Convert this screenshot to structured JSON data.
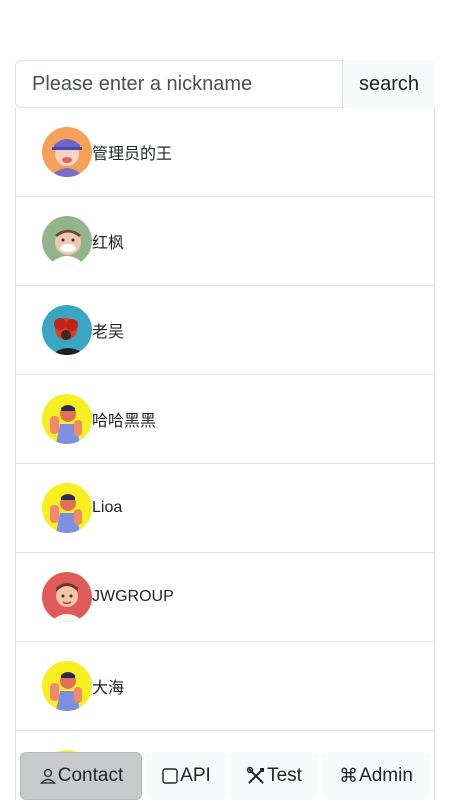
{
  "search": {
    "placeholder": "Please enter a nickname",
    "button_label": "search"
  },
  "contacts": [
    {
      "name": "管理员的王",
      "avatar": "orange-cap-avatar"
    },
    {
      "name": "红枫",
      "avatar": "green-old-man-avatar"
    },
    {
      "name": "老吴",
      "avatar": "teal-red-hair-avatar"
    },
    {
      "name": "哈哈黑黑",
      "avatar": "yellow-hand-avatar"
    },
    {
      "name": "Lioa",
      "avatar": "yellow-hand-avatar"
    },
    {
      "name": "JWGROUP",
      "avatar": "red-man-avatar"
    },
    {
      "name": "大海",
      "avatar": "yellow-hand-avatar"
    },
    {
      "name": "",
      "avatar": "yellow-hand-avatar"
    }
  ],
  "tabs": [
    {
      "label": "Contact",
      "icon": "person-icon",
      "active": true
    },
    {
      "label": "API",
      "icon": "square-icon",
      "active": false
    },
    {
      "label": "Test",
      "icon": "tools-icon",
      "active": false
    },
    {
      "label": "Admin",
      "icon": "command-icon",
      "active": false
    }
  ]
}
